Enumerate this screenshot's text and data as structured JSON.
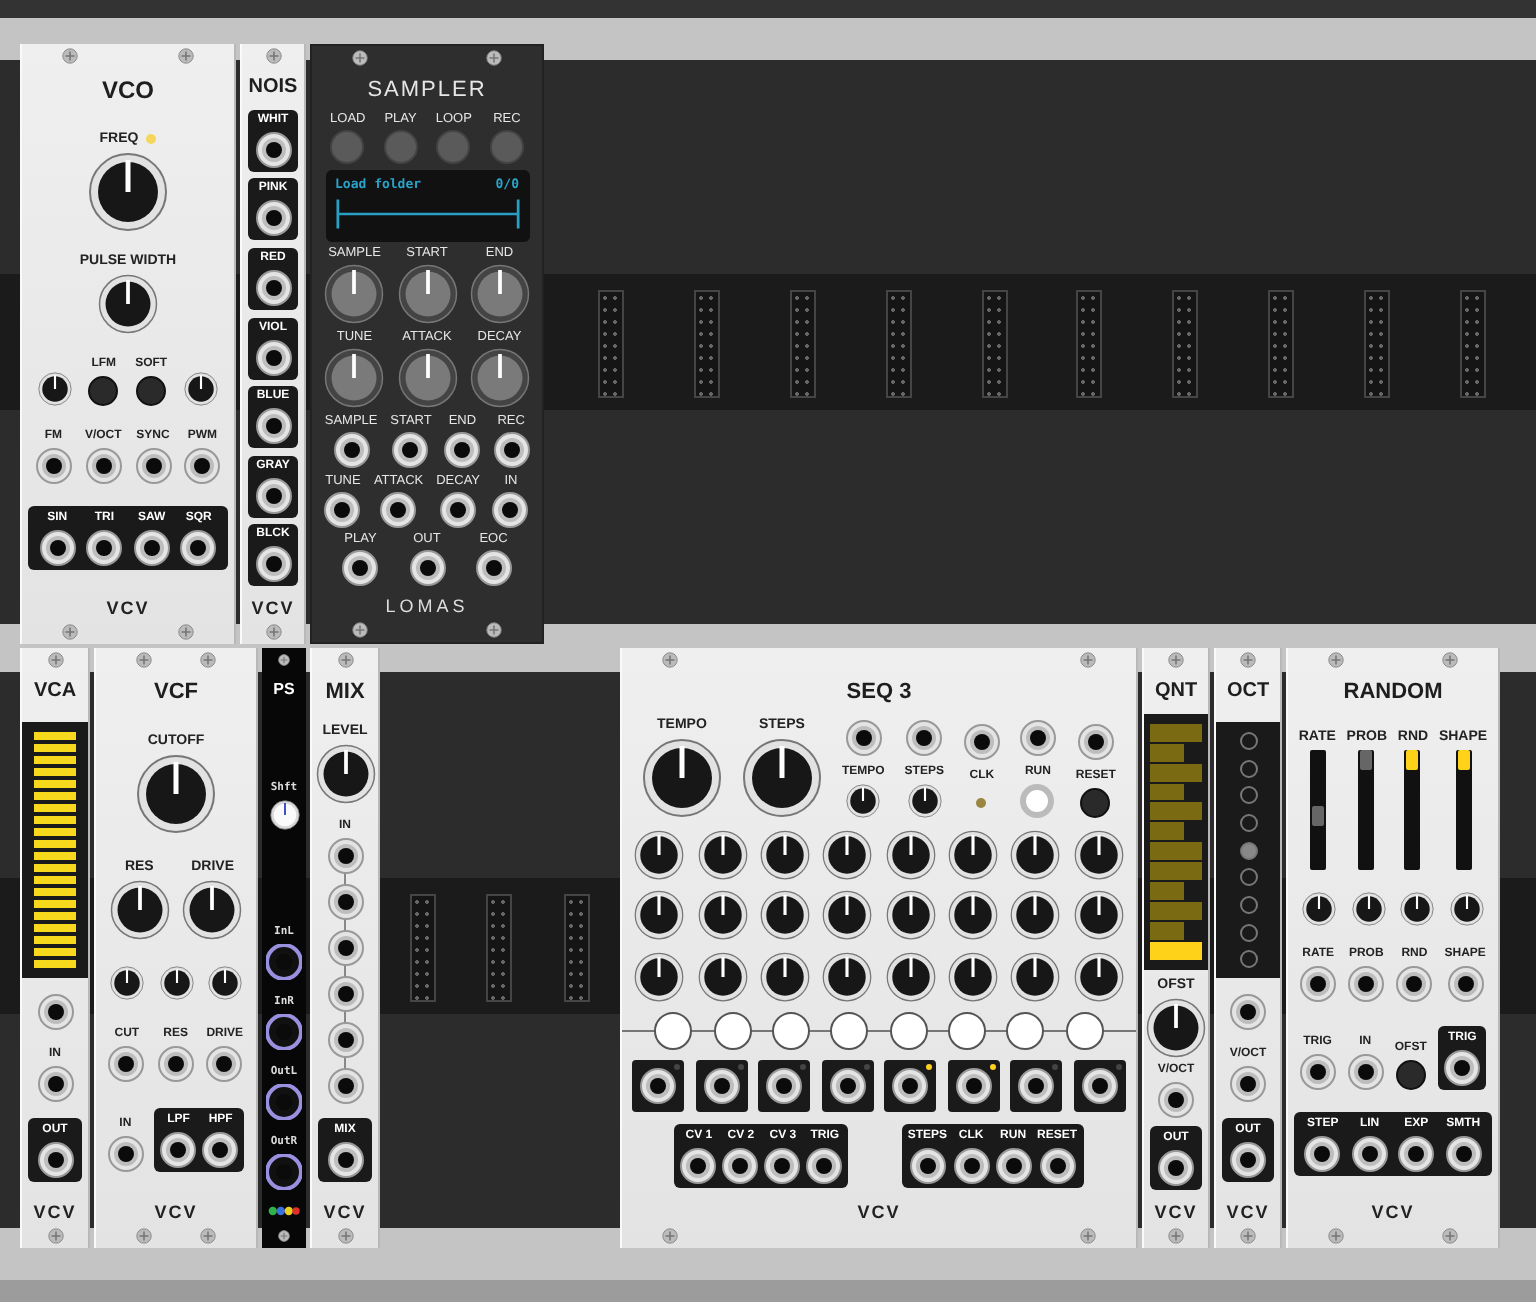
{
  "rows": [
    {
      "modules": [
        {
          "kind": "vco",
          "title": "VCO",
          "brand": "VCV",
          "sections": [
            {
              "kind": "row",
              "items": [
                {
                  "kind": "big-knob",
                  "label": "FREQ",
                  "lit": true
                }
              ]
            },
            {
              "kind": "row",
              "items": [
                {
                  "kind": "knob",
                  "label": "PULSE WIDTH"
                }
              ]
            },
            {
              "kind": "row",
              "items": [
                {
                  "kind": "small-knob"
                },
                {
                  "kind": "button",
                  "label": "LFM"
                },
                {
                  "kind": "button",
                  "label": "SOFT"
                },
                {
                  "kind": "small-knob"
                }
              ]
            },
            {
              "kind": "row",
              "items": [
                {
                  "kind": "jack",
                  "label": "FM"
                },
                {
                  "kind": "jack",
                  "label": "V/OCT"
                },
                {
                  "kind": "jack",
                  "label": "SYNC"
                },
                {
                  "kind": "jack",
                  "label": "PWM"
                }
              ]
            },
            {
              "kind": "box",
              "items": [
                {
                  "kind": "jack",
                  "label": "SIN"
                },
                {
                  "kind": "jack",
                  "label": "TRI"
                },
                {
                  "kind": "jack",
                  "label": "SAW"
                },
                {
                  "kind": "jack",
                  "label": "SQR"
                }
              ]
            }
          ]
        },
        {
          "kind": "noise",
          "title": "NOIS",
          "brand": "VCV",
          "sections": [
            {
              "kind": "box",
              "items": [
                {
                  "kind": "jack",
                  "label": "WHIT"
                }
              ]
            },
            {
              "kind": "box",
              "items": [
                {
                  "kind": "jack",
                  "label": "PINK"
                }
              ]
            },
            {
              "kind": "box",
              "items": [
                {
                  "kind": "jack",
                  "label": "RED"
                }
              ]
            },
            {
              "kind": "box",
              "items": [
                {
                  "kind": "jack",
                  "label": "VIOL"
                }
              ]
            },
            {
              "kind": "box",
              "items": [
                {
                  "kind": "jack",
                  "label": "BLUE"
                }
              ]
            },
            {
              "kind": "box",
              "items": [
                {
                  "kind": "jack",
                  "label": "GRAY"
                }
              ]
            },
            {
              "kind": "box",
              "items": [
                {
                  "kind": "jack",
                  "label": "BLCK"
                }
              ]
            }
          ]
        },
        {
          "kind": "sampler",
          "title": "SAMPLER",
          "brand": "LOMAS",
          "sections": [
            {
              "kind": "row",
              "items": [
                {
                  "kind": "grey-button",
                  "label": "LOAD"
                },
                {
                  "kind": "grey-button",
                  "label": "PLAY"
                },
                {
                  "kind": "grey-button",
                  "label": "LOOP"
                },
                {
                  "kind": "grey-button",
                  "label": "REC"
                }
              ]
            },
            {
              "kind": "display",
              "text": "Load folder",
              "counter": "0/0"
            },
            {
              "kind": "row",
              "items": [
                {
                  "kind": "grey-knob",
                  "label": "SAMPLE"
                },
                {
                  "kind": "grey-knob",
                  "label": "START"
                },
                {
                  "kind": "grey-knob",
                  "label": "END"
                }
              ]
            },
            {
              "kind": "row",
              "items": [
                {
                  "kind": "grey-knob",
                  "label": "TUNE"
                },
                {
                  "kind": "grey-knob",
                  "label": "ATTACK"
                },
                {
                  "kind": "grey-knob",
                  "label": "DECAY"
                }
              ]
            },
            {
              "kind": "row",
              "items": [
                {
                  "kind": "jack",
                  "label": "SAMPLE"
                },
                {
                  "kind": "jack",
                  "label": "START"
                },
                {
                  "kind": "jack",
                  "label": "END"
                },
                {
                  "kind": "jack",
                  "label": "REC"
                }
              ]
            },
            {
              "kind": "row",
              "items": [
                {
                  "kind": "jack",
                  "label": "TUNE"
                },
                {
                  "kind": "jack",
                  "label": "ATTACK"
                },
                {
                  "kind": "jack",
                  "label": "DECAY"
                },
                {
                  "kind": "jack",
                  "label": "IN"
                }
              ]
            },
            {
              "kind": "row",
              "items": [
                {
                  "kind": "jack",
                  "label": "PLAY"
                },
                {
                  "kind": "jack",
                  "label": "OUT"
                },
                {
                  "kind": "jack",
                  "label": "EOC"
                }
              ]
            }
          ]
        }
      ]
    },
    {
      "modules": [
        {
          "kind": "vca",
          "title": "VCA",
          "brand": "VCV",
          "sections": [
            {
              "kind": "meter",
              "level": 1
            },
            {
              "kind": "row",
              "items": [
                {
                  "kind": "jack"
                }
              ]
            },
            {
              "kind": "row",
              "items": [
                {
                  "kind": "jack",
                  "label": "IN"
                }
              ]
            },
            {
              "kind": "box",
              "items": [
                {
                  "kind": "jack",
                  "label": "OUT"
                }
              ]
            }
          ]
        },
        {
          "kind": "vcf",
          "title": "VCF",
          "brand": "VCV",
          "sections": [
            {
              "kind": "row",
              "items": [
                {
                  "kind": "big-knob",
                  "label": "CUTOFF"
                }
              ]
            },
            {
              "kind": "row",
              "items": [
                {
                  "kind": "knob",
                  "label": "RES"
                },
                {
                  "kind": "knob",
                  "label": "DRIVE"
                }
              ]
            },
            {
              "kind": "row",
              "items": [
                {
                  "kind": "small-knob"
                },
                {
                  "kind": "small-knob"
                },
                {
                  "kind": "small-knob"
                }
              ]
            },
            {
              "kind": "row",
              "items": [
                {
                  "kind": "jack",
                  "label": "CUT"
                },
                {
                  "kind": "jack",
                  "label": "RES"
                },
                {
                  "kind": "jack",
                  "label": "DRIVE"
                }
              ]
            },
            {
              "kind": "row",
              "items": [
                {
                  "kind": "jack",
                  "label": "IN"
                },
                {
                  "kind": "box",
                  "items": [
                    {
                      "kind": "jack",
                      "label": "LPF"
                    },
                    {
                      "kind": "jack",
                      "label": "HPF"
                    }
                  ]
                }
              ]
            }
          ]
        },
        {
          "kind": "ps",
          "title": "PS",
          "sections": [
            {
              "kind": "row",
              "items": [
                {
                  "kind": "trim-knob",
                  "label": "Shft"
                }
              ]
            },
            {
              "kind": "row",
              "items": [
                {
                  "kind": "ring-jack",
                  "label": "InL"
                }
              ]
            },
            {
              "kind": "row",
              "items": [
                {
                  "kind": "ring-jack",
                  "label": "InR"
                }
              ]
            },
            {
              "kind": "row",
              "items": [
                {
                  "kind": "ring-jack",
                  "label": "OutL"
                }
              ]
            },
            {
              "kind": "row",
              "items": [
                {
                  "kind": "ring-jack",
                  "label": "OutR"
                }
              ]
            }
          ]
        },
        {
          "kind": "mix",
          "title": "MIX",
          "brand": "VCV",
          "sections": [
            {
              "kind": "row",
              "items": [
                {
                  "kind": "knob",
                  "label": "LEVEL"
                }
              ]
            },
            {
              "kind": "column",
              "items": [
                {
                  "kind": "jack",
                  "label": "IN"
                },
                {
                  "kind": "jack"
                },
                {
                  "kind": "jack"
                },
                {
                  "kind": "jack"
                },
                {
                  "kind": "jack"
                },
                {
                  "kind": "jack"
                }
              ]
            },
            {
              "kind": "box",
              "items": [
                {
                  "kind": "jack",
                  "label": "MIX"
                }
              ]
            }
          ]
        },
        {
          "kind": "seq",
          "title": "SEQ 3",
          "brand": "VCV",
          "sections": [
            {
              "kind": "row",
              "items": [
                {
                  "kind": "big-knob",
                  "label": "TEMPO"
                },
                {
                  "kind": "big-knob",
                  "label": "STEPS"
                },
                {
                  "kind": "group",
                  "items": [
                    {
                      "kind": "jack"
                    },
                    {
                      "kind": "small-knob",
                      "label": "TEMPO"
                    }
                  ]
                },
                {
                  "kind": "group",
                  "items": [
                    {
                      "kind": "jack"
                    },
                    {
                      "kind": "small-knob",
                      "label": "STEPS"
                    }
                  ]
                },
                {
                  "kind": "group",
                  "items": [
                    {
                      "kind": "jack"
                    },
                    {
                      "kind": "light",
                      "label": "CLK",
                      "lit": false
                    }
                  ]
                },
                {
                  "kind": "group",
                  "items": [
                    {
                      "kind": "jack"
                    },
                    {
                      "kind": "switch",
                      "label": "RUN"
                    }
                  ]
                },
                {
                  "kind": "group",
                  "items": [
                    {
                      "kind": "jack"
                    },
                    {
                      "kind": "button",
                      "label": "RESET"
                    }
                  ]
                }
              ]
            },
            {
              "kind": "row",
              "items": [
                {
                  "kind": "seq-knob"
                },
                {
                  "kind": "seq-knob"
                },
                {
                  "kind": "seq-knob"
                },
                {
                  "kind": "seq-knob"
                },
                {
                  "kind": "seq-knob"
                },
                {
                  "kind": "seq-knob"
                },
                {
                  "kind": "seq-knob"
                },
                {
                  "kind": "seq-knob"
                }
              ]
            },
            {
              "kind": "row",
              "items": [
                {
                  "kind": "seq-knob"
                },
                {
                  "kind": "seq-knob"
                },
                {
                  "kind": "seq-knob"
                },
                {
                  "kind": "seq-knob"
                },
                {
                  "kind": "seq-knob"
                },
                {
                  "kind": "seq-knob"
                },
                {
                  "kind": "seq-knob"
                },
                {
                  "kind": "seq-knob"
                }
              ]
            },
            {
              "kind": "row",
              "items": [
                {
                  "kind": "seq-knob"
                },
                {
                  "kind": "seq-knob"
                },
                {
                  "kind": "seq-knob"
                },
                {
                  "kind": "seq-knob"
                },
                {
                  "kind": "seq-knob"
                },
                {
                  "kind": "seq-knob"
                },
                {
                  "kind": "seq-knob"
                },
                {
                  "kind": "seq-knob"
                }
              ]
            },
            {
              "kind": "steps",
              "items": [
                {
                  "kind": "step",
                  "on": false
                },
                {
                  "kind": "step",
                  "on": false
                },
                {
                  "kind": "step",
                  "on": false
                },
                {
                  "kind": "step",
                  "on": false
                },
                {
                  "kind": "step",
                  "on": false
                },
                {
                  "kind": "step",
                  "on": false
                },
                {
                  "kind": "step",
                  "on": false
                },
                {
                  "kind": "step",
                  "on": false
                }
              ]
            },
            {
              "kind": "row",
              "items": [
                {
                  "kind": "boxed-jack",
                  "lit": false
                },
                {
                  "kind": "boxed-jack",
                  "lit": false
                },
                {
                  "kind": "boxed-jack",
                  "lit": false
                },
                {
                  "kind": "boxed-jack",
                  "lit": false
                },
                {
                  "kind": "boxed-jack",
                  "lit": true
                },
                {
                  "kind": "boxed-jack",
                  "lit": true
                },
                {
                  "kind": "boxed-jack",
                  "lit": false
                },
                {
                  "kind": "boxed-jack",
                  "lit": false
                }
              ]
            },
            {
              "kind": "row",
              "items": [
                {
                  "kind": "box",
                  "items": [
                    {
                      "kind": "jack",
                      "label": "CV 1"
                    },
                    {
                      "kind": "jack",
                      "label": "CV 2"
                    },
                    {
                      "kind": "jack",
                      "label": "CV 3"
                    },
                    {
                      "kind": "jack",
                      "label": "TRIG"
                    }
                  ]
                },
                {
                  "kind": "box",
                  "items": [
                    {
                      "kind": "jack",
                      "label": "STEPS"
                    },
                    {
                      "kind": "jack",
                      "label": "CLK"
                    },
                    {
                      "kind": "jack",
                      "label": "RUN"
                    },
                    {
                      "kind": "jack",
                      "label": "RESET"
                    }
                  ]
                }
              ]
            }
          ]
        },
        {
          "kind": "qnt",
          "title": "QNT",
          "brand": "VCV",
          "sections": [
            {
              "kind": "keys",
              "keys": [
                {
                  "on": true
                },
                {
                  "on": false
                },
                {
                  "on": false
                },
                {
                  "on": false
                },
                {
                  "on": false
                },
                {
                  "on": false
                },
                {
                  "on": false
                },
                {
                  "on": false
                },
                {
                  "on": false
                },
                {
                  "on": false
                },
                {
                  "on": false
                },
                {
                  "on": false
                }
              ]
            },
            {
              "kind": "row",
              "items": [
                {
                  "kind": "knob",
                  "label": "OFST"
                }
              ]
            },
            {
              "kind": "row",
              "items": [
                {
                  "kind": "jack",
                  "label": "V/OCT"
                }
              ]
            },
            {
              "kind": "box",
              "items": [
                {
                  "kind": "jack",
                  "label": "OUT"
                }
              ]
            }
          ]
        },
        {
          "kind": "oct",
          "title": "OCT",
          "brand": "VCV",
          "sections": [
            {
              "kind": "octaves",
              "octaves": [
                {
                  "selected": false
                },
                {
                  "selected": false
                },
                {
                  "selected": false
                },
                {
                  "selected": false
                },
                {
                  "selected": true
                },
                {
                  "selected": false
                },
                {
                  "selected": false
                },
                {
                  "selected": false
                },
                {
                  "selected": false
                }
              ]
            },
            {
              "kind": "row",
              "items": [
                {
                  "kind": "jack"
                }
              ]
            },
            {
              "kind": "row",
              "items": [
                {
                  "kind": "jack",
                  "label": "V/OCT"
                }
              ]
            },
            {
              "kind": "box",
              "items": [
                {
                  "kind": "jack",
                  "label": "OUT"
                }
              ]
            }
          ]
        },
        {
          "kind": "random",
          "title": "RANDOM",
          "brand": "VCV",
          "sections": [
            {
              "kind": "sliders",
              "sliders": [
                {
                  "label": "RATE",
                  "level": 0.45,
                  "lit": false
                },
                {
                  "label": "PROB",
                  "level": 1,
                  "lit": false
                },
                {
                  "label": "RND",
                  "level": 1,
                  "lit": true
                },
                {
                  "label": "SHAPE",
                  "level": 1,
                  "lit": true
                }
              ]
            },
            {
              "kind": "row",
              "items": [
                {
                  "kind": "small-knob"
                },
                {
                  "kind": "small-knob"
                },
                {
                  "kind": "small-knob"
                },
                {
                  "kind": "small-knob"
                }
              ]
            },
            {
              "kind": "row",
              "items": [
                {
                  "kind": "jack",
                  "label": "RATE"
                },
                {
                  "kind": "jack",
                  "label": "PROB"
                },
                {
                  "kind": "jack",
                  "label": "RND"
                },
                {
                  "kind": "jack",
                  "label": "SHAPE"
                }
              ]
            },
            {
              "kind": "row",
              "items": [
                {
                  "kind": "jack",
                  "label": "TRIG"
                },
                {
                  "kind": "jack",
                  "label": "IN"
                },
                {
                  "kind": "button",
                  "label": "OFST"
                },
                {
                  "kind": "box",
                  "items": [
                    {
                      "kind": "jack",
                      "label": "TRIG"
                    }
                  ]
                }
              ]
            },
            {
              "kind": "box",
              "items": [
                {
                  "kind": "jack",
                  "label": "STEP"
                },
                {
                  "kind": "jack",
                  "label": "LIN"
                },
                {
                  "kind": "jack",
                  "label": "EXP"
                },
                {
                  "kind": "jack",
                  "label": "SMTH"
                }
              ]
            }
          ]
        }
      ]
    }
  ]
}
